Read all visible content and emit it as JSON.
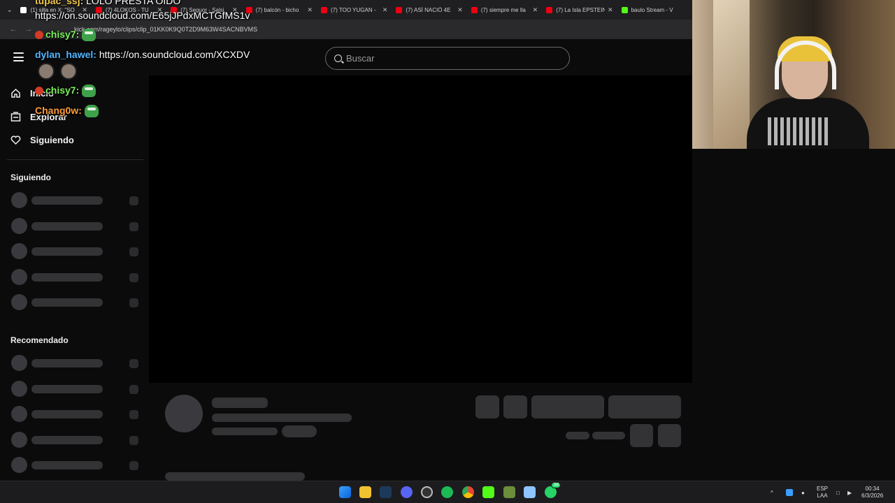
{
  "browser": {
    "tabs": [
      {
        "title": "(1) silla en X: \"SO",
        "favicon": "x"
      },
      {
        "title": "(7) 4LOKOS - TU",
        "favicon": "yt"
      },
      {
        "title": "(7) Seguor - Salsi",
        "favicon": "yt"
      },
      {
        "title": "(7) balcón - bicho",
        "favicon": "yt"
      },
      {
        "title": "(7) TOO YUGAN -",
        "favicon": "yt"
      },
      {
        "title": "(7) ASÍ NACIÓ 4E",
        "favicon": "yt"
      },
      {
        "title": "(7) siempre me lla",
        "favicon": "yt"
      },
      {
        "title": "(7) La Isla EPSTEIN",
        "favicon": "yt"
      },
      {
        "title": "baulo Stream - V",
        "favicon": "kick"
      }
    ],
    "url": "kick.com/rageylo/clips/clip_01KK0K9Q0T2D9M63W4SACNBVMS"
  },
  "chat": {
    "messages": [
      {
        "user": "tupac_ssj:",
        "text": "LOLO PRESTA OIDO",
        "color": "#f2c94c"
      },
      {
        "user": "",
        "text": "https://on.soundcloud.com/E65jJPdxMCTGfMS1v",
        "color": "#ffffff"
      },
      {
        "user": "chisy7:",
        "text": "",
        "color": "#7cf05a"
      },
      {
        "user": "dylan_hawel:",
        "text": "https://on.soundcloud.com/XCXDV",
        "color": "#52b6ff"
      },
      {
        "user": "chisy7:",
        "text": "",
        "color": "#7cf05a"
      },
      {
        "user": "Chang0w:",
        "text": "",
        "color": "#ff9c3a"
      }
    ]
  },
  "header": {
    "search_placeholder": "Buscar"
  },
  "sidebar": {
    "nav": [
      {
        "label": "Inicio",
        "icon": "home-icon"
      },
      {
        "label": "Explorar",
        "icon": "browse-icon"
      },
      {
        "label": "Siguiendo",
        "icon": "heart-icon"
      }
    ],
    "following_title": "Siguiendo",
    "recommended_title": "Recomendado"
  },
  "taskbar": {
    "lang_top": "ESP",
    "lang_bottom": "LAA",
    "time": "00:34",
    "date": "6/3/2026",
    "whatsapp_badge": "38"
  },
  "colors": {
    "background": "#0b0b0c",
    "skeleton": "#333336",
    "kick_green": "#53fc18"
  }
}
